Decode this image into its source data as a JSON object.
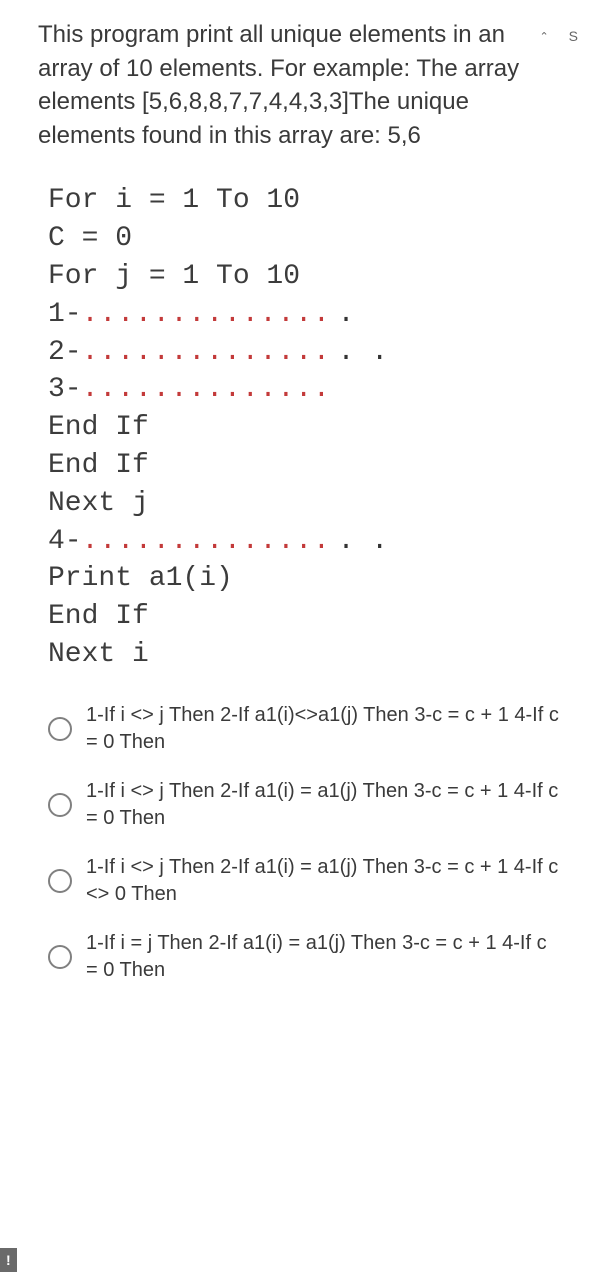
{
  "topright": {
    "chev": "⌃",
    "s": "S"
  },
  "question": "This program print all unique elements in an array of 10 elements. For example: The array elements  [5,6,8,8,7,7,4,4,3,3]The unique elements found in this array are: 5,6",
  "code": {
    "l1": "For i = 1 To 10",
    "l2": "C = 0",
    "l3": "For j = 1 To 10",
    "b1p": "1-",
    "b1d": "............................",
    "b1s": ".",
    "b2p": "2-",
    "b2d": "...........................",
    "b2s": ". .",
    "b3p": "3-",
    "b3d": ".............................",
    "b3s": "",
    "l4": "End If",
    "l5": "End If",
    "l6": "Next j",
    "b4p": "4-",
    "b4d": "..........................",
    "b4s": ". .",
    "l7": "Print a1(i)",
    "l8": "End If",
    "l9": "Next i"
  },
  "options": [
    "1-If i <> j Then 2-If a1(i)<>a1(j) Then 3-c = c + 1 4-If c = 0 Then",
    "1-If i <> j Then 2-If a1(i) = a1(j) Then 3-c = c + 1 4-If c = 0 Then",
    "1-If i <> j Then 2-If a1(i) = a1(j) Then 3-c = c + 1 4-If c <> 0 Then",
    "1-If i = j Then 2-If a1(i) = a1(j) Then 3-c = c + 1 4-If c = 0 Then"
  ],
  "badge": "!"
}
